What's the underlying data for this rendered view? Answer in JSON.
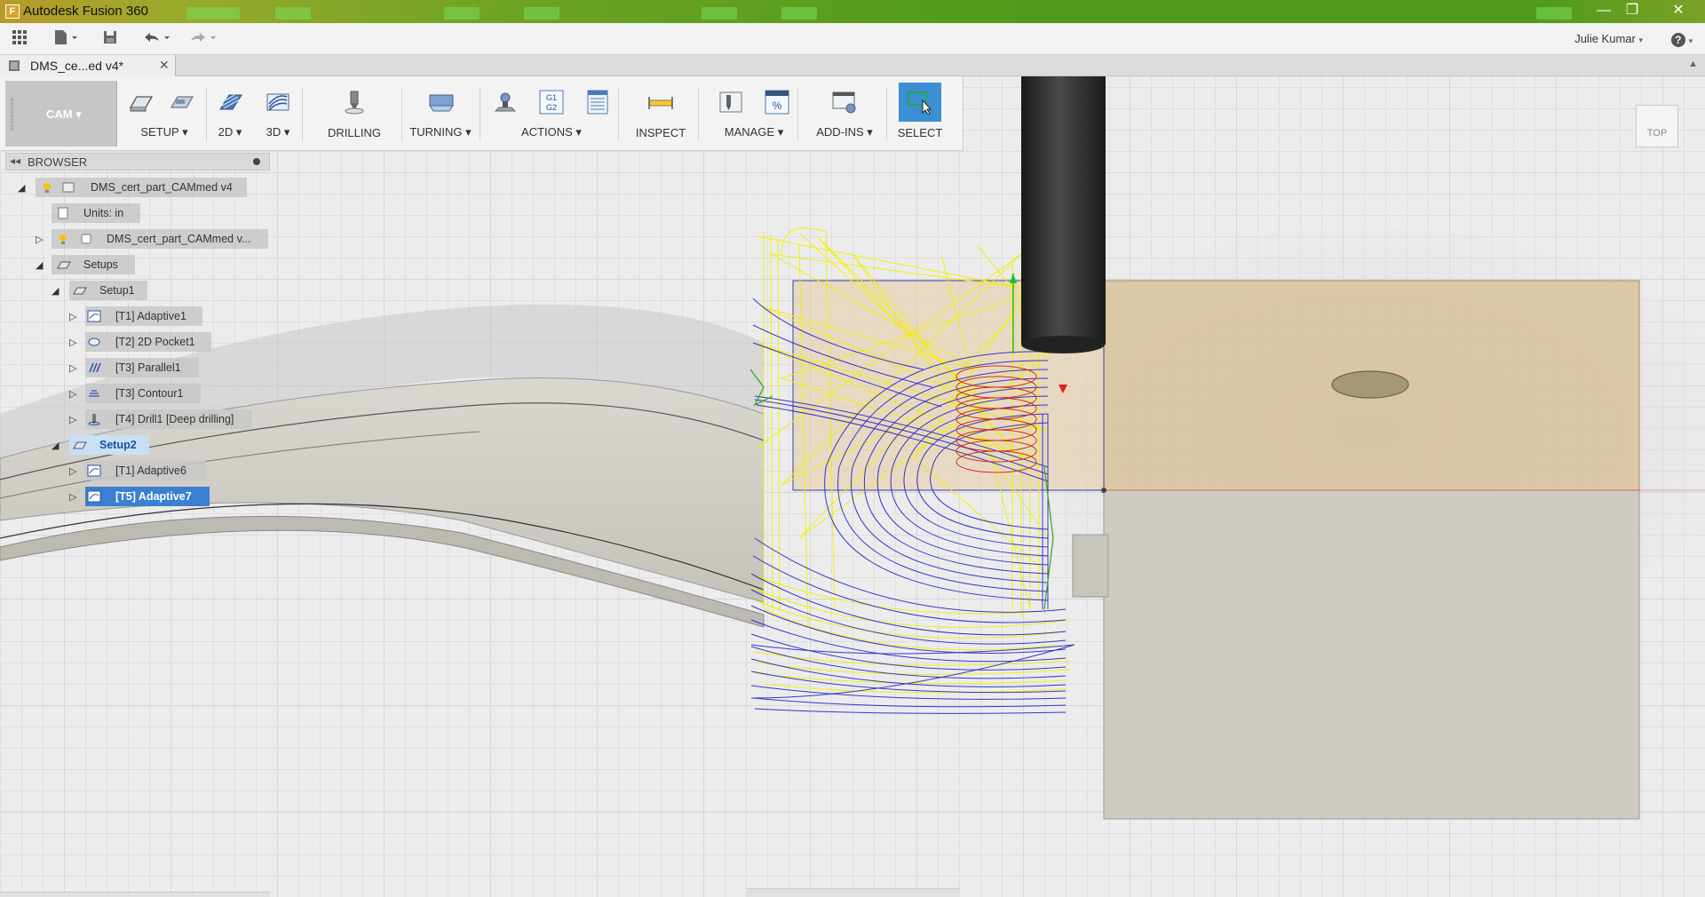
{
  "window": {
    "title": "Autodesk Fusion 360",
    "app_icon_letter": "F",
    "minimize": "—",
    "maximize": "❐",
    "close": "✕"
  },
  "qat": {
    "user": "Julie Kumar",
    "user_caret": "▾",
    "help": "?",
    "help_caret": "▾"
  },
  "document_tab": {
    "label": "DMS_ce...ed v4*",
    "close": "✕"
  },
  "toolbar": {
    "workspace": "CAM ▾",
    "groups": [
      {
        "label": "SETUP ▾"
      },
      {
        "label": "2D ▾"
      },
      {
        "label": "3D ▾"
      },
      {
        "label": "DRILLING"
      },
      {
        "label": "TURNING ▾"
      },
      {
        "label": "ACTIONS ▾"
      },
      {
        "label": "INSPECT"
      },
      {
        "label": "MANAGE ▾"
      },
      {
        "label": "ADD-INS ▾"
      },
      {
        "label": "SELECT"
      }
    ],
    "gcode_icon_text": "G1 G2",
    "percent_icon_text": "%"
  },
  "browser": {
    "title": "BROWSER",
    "collapse": "◂◂",
    "nodes": [
      {
        "label": "DMS_cert_part_CAMmed v4"
      },
      {
        "label": "Units: in"
      },
      {
        "label": "DMS_cert_part_CAMmed v..."
      },
      {
        "label": "Setups"
      },
      {
        "label": "Setup1"
      },
      {
        "label": "[T1] Adaptive1"
      },
      {
        "label": "[T2] 2D Pocket1"
      },
      {
        "label": "[T3] Parallel1"
      },
      {
        "label": "[T3] Contour1"
      },
      {
        "label": "[T4] Drill1 [Deep drilling]"
      },
      {
        "label": "Setup2"
      },
      {
        "label": "[T1] Adaptive6"
      },
      {
        "label": "[T5] Adaptive7"
      }
    ]
  },
  "viewcube": {
    "label": "TOP"
  },
  "colors": {
    "titlebar_green": "#4f9a1c",
    "selection_blue": "#3b7fd0",
    "toolpath_yellow": "#f4f000",
    "toolpath_blue": "#1a1ad0",
    "stock_tan": "#d8c19a",
    "part_gray": "#cfcdc6",
    "tool_black": "#2a2a2a"
  }
}
